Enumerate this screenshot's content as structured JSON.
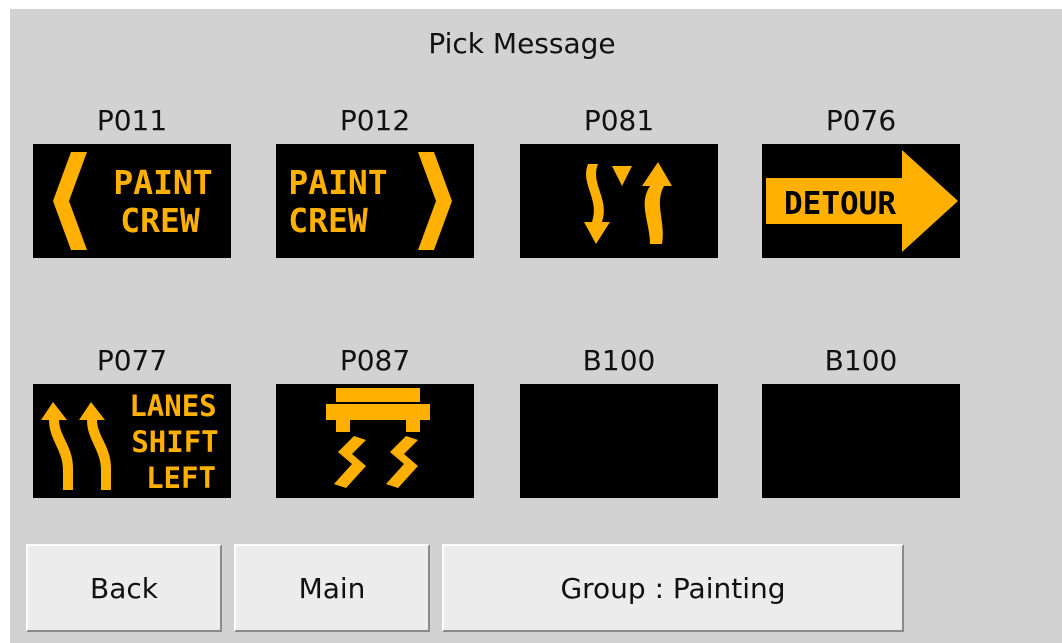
{
  "title": "Pick Message",
  "sign_color": "#FFB000",
  "messages": [
    {
      "code": "P011",
      "sign": "arrow-left",
      "lines": [
        "PAINT",
        "CREW"
      ]
    },
    {
      "code": "P012",
      "sign": "arrow-right",
      "lines": [
        "PAINT",
        "CREW"
      ]
    },
    {
      "code": "P081",
      "sign": "merge-arrows",
      "lines": []
    },
    {
      "code": "P076",
      "sign": "detour-arrow",
      "lines": [
        "DETOUR"
      ]
    },
    {
      "code": "P077",
      "sign": "lanes-shift-left",
      "lines": [
        "LANES",
        "SHIFT",
        "LEFT"
      ]
    },
    {
      "code": "P087",
      "sign": "slippery-road",
      "lines": []
    },
    {
      "code": "B100",
      "sign": "blank",
      "lines": []
    },
    {
      "code": "B100",
      "sign": "blank",
      "lines": []
    }
  ],
  "buttons": {
    "back": "Back",
    "main": "Main",
    "group": "Group : Painting"
  }
}
